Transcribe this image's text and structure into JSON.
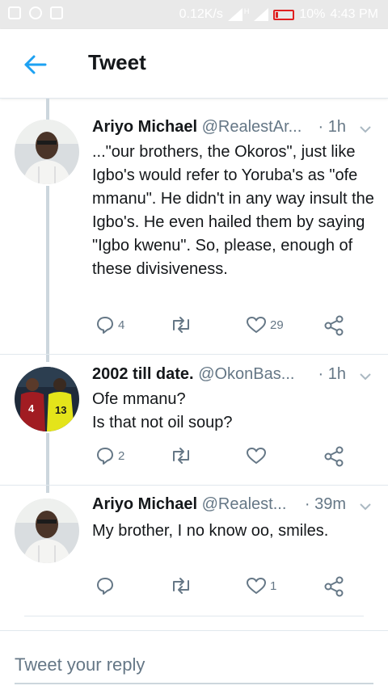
{
  "status_bar": {
    "network_speed": "0.12K/s",
    "signal_label": "H",
    "battery": "10%",
    "time": "4:43 PM",
    "battery_color": "#e02020"
  },
  "header": {
    "title": "Tweet",
    "back_icon": "arrow-left-icon",
    "accent_color": "#1da1f2"
  },
  "tweets": [
    {
      "name": "Ariyo Michael",
      "handle": "@RealestAr...",
      "time": "· 1h",
      "text": "...\"our brothers, the Okoros\", just like Igbo's would refer to Yoruba's as \"ofe mmanu\". He didn't in any way insult the Igbo's. He even hailed them by saying \"Igbo kwenu\". So, please, enough of these divisiveness.",
      "replies": "4",
      "retweets": "",
      "likes": "29"
    },
    {
      "name": "2002 till date.",
      "handle": "@OkonBas...",
      "time": "· 1h",
      "text": "Ofe mmanu?\nIs that not oil soup?",
      "replies": "2",
      "retweets": "",
      "likes": ""
    },
    {
      "name": "Ariyo Michael",
      "handle": "@Realest...",
      "time": "· 39m",
      "text": "My brother, I no know oo, smiles.",
      "replies": "",
      "retweets": "",
      "likes": "1"
    }
  ],
  "reply": {
    "placeholder": "Tweet your reply"
  }
}
